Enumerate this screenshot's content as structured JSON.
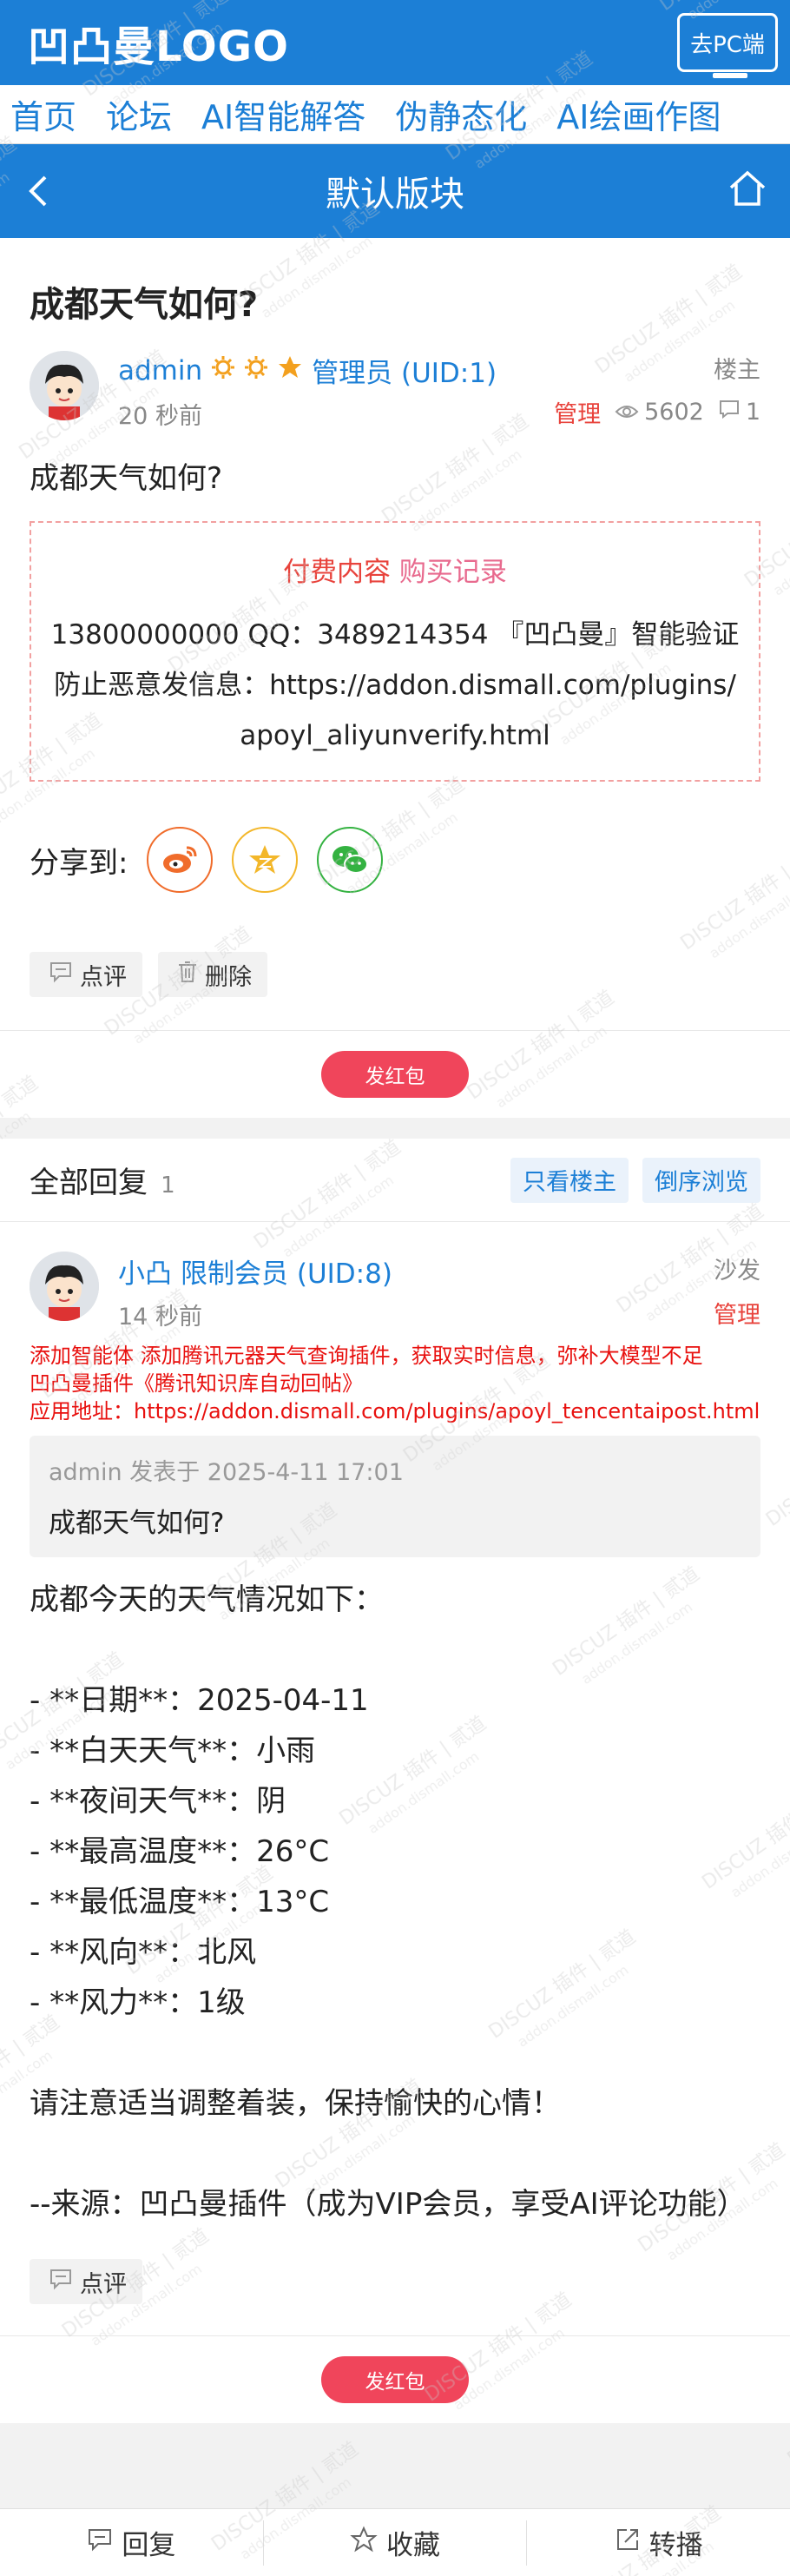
{
  "header": {
    "logo": "凹凸曼LOGO",
    "pc_button": "去PC端"
  },
  "nav": [
    "首页",
    "论坛",
    "AI智能解答",
    "伪静态化",
    "AI绘画作图"
  ],
  "board": {
    "title": "默认版块"
  },
  "thread": {
    "title": "成都天气如何?",
    "author": {
      "name": "admin",
      "group": "管理员 (UID:1)",
      "time": "20 秒前",
      "floor": "楼主",
      "manage": "管理",
      "views": "5602",
      "replies": "1"
    },
    "body": "成都天气如何?",
    "paid": {
      "label": "付费内容",
      "record": "购买记录",
      "text": "13800000000 QQ：3489214354 『凹凸曼』智能验证 防止恶意发信息：https://addon.dismall.com/plugins/apoyl_aliyunverify.html"
    },
    "share_label": "分享到:",
    "comment": "点评",
    "delete": "删除",
    "redpacket": "发红包"
  },
  "replies_header": {
    "title": "全部回复",
    "count": "1",
    "only_op": "只看楼主",
    "reverse": "倒序浏览"
  },
  "reply": {
    "author": {
      "name": "小凸",
      "group": "限制会员 (UID:8)",
      "time": "14 秒前",
      "floor": "沙发",
      "manage": "管理"
    },
    "notice_1": "添加智能体 添加腾讯元器天气查询插件，获取实时信息，弥补大模型不足",
    "notice_2": "凹凸曼插件《腾讯知识库自动回帖》",
    "notice_3": "应用地址：https://addon.dismall.com/plugins/apoyl_tencentaipost.html",
    "quote_meta": "admin 发表于 2025-4-11 17:01",
    "quote_text": "成都天气如何?",
    "body": "成都今天的天气情况如下：\n\n- **日期**：2025-04-11\n- **白天天气**：小雨\n- **夜间天气**：阴\n- **最高温度**：26°C\n- **最低温度**：13°C\n- **风向**：北风\n- **风力**：1级\n\n请注意适当调整着装，保持愉快的心情！\n\n--来源：凹凸曼插件（成为VIP会员，享受AI评论功能）",
    "comment": "点评",
    "redpacket": "发红包"
  },
  "bottom": {
    "reply": "回复",
    "favorite": "收藏",
    "share": "转播"
  },
  "colors": {
    "primary": "#1c7fd6",
    "danger": "#e8433c",
    "redpacket": "#f0455b"
  }
}
